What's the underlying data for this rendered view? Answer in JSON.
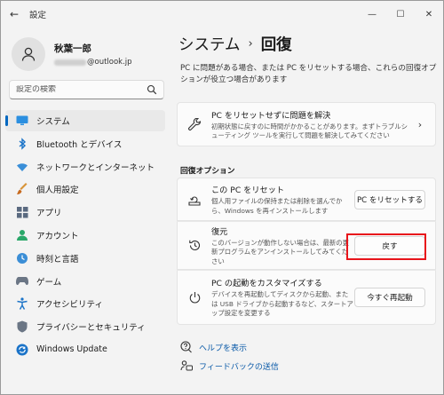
{
  "app": {
    "title": "設定"
  },
  "window_controls": {
    "minimize": "—",
    "maximize": "☐",
    "close": "✕"
  },
  "profile": {
    "name": "秋葉一郎",
    "email_domain": "@outlook.jp"
  },
  "search": {
    "placeholder": "設定の検索"
  },
  "sidebar": {
    "items": [
      {
        "label": "システム",
        "icon": "system-icon",
        "active": true
      },
      {
        "label": "Bluetooth とデバイス",
        "icon": "bluetooth-icon"
      },
      {
        "label": "ネットワークとインターネット",
        "icon": "wifi-icon"
      },
      {
        "label": "個人用設定",
        "icon": "brush-icon"
      },
      {
        "label": "アプリ",
        "icon": "apps-icon"
      },
      {
        "label": "アカウント",
        "icon": "account-icon"
      },
      {
        "label": "時刻と言語",
        "icon": "time-language-icon"
      },
      {
        "label": "ゲーム",
        "icon": "game-icon"
      },
      {
        "label": "アクセシビリティ",
        "icon": "accessibility-icon"
      },
      {
        "label": "プライバシーとセキュリティ",
        "icon": "shield-icon"
      },
      {
        "label": "Windows Update",
        "icon": "update-icon"
      }
    ]
  },
  "main": {
    "breadcrumb": {
      "parent": "システム",
      "separator": "›",
      "current": "回復"
    },
    "intro": "PC に問題がある場合、または PC をリセットする場合、これらの回復オプションが役立つ場合があります",
    "troubleshoot_card": {
      "title": "PC をリセットせずに問題を解決",
      "desc": "初期状態に戻すのに時間がかかることがあります。まずトラブルシューティング ツールを実行して問題を解決してみてください",
      "chevron": "›"
    },
    "section_label": "回復オプション",
    "options": [
      {
        "title": "この PC をリセット",
        "desc": "個人用ファイルの保持または削除を選んでから、Windows を再インストールします",
        "button": "PC をリセットする",
        "icon": "reset-pc-icon"
      },
      {
        "title": "復元",
        "desc": "このバージョンが動作しない場合は、最新の更新プログラムをアンインストールしてみてください",
        "button": "戻す",
        "icon": "restore-icon"
      },
      {
        "title": "PC の起動をカスタマイズする",
        "desc": "デバイスを再起動してディスクから起動、または USB ドライブから起動するなど、スタートアップ設定を変更する",
        "button": "今すぐ再起動",
        "icon": "power-icon"
      }
    ],
    "links": [
      {
        "label": "ヘルプを表示",
        "icon": "help-icon"
      },
      {
        "label": "フィードバックの送信",
        "icon": "feedback-icon"
      }
    ]
  },
  "colors": {
    "accent": "#0067c0",
    "highlight_border": "#e8141b",
    "link": "#0a5aa8"
  }
}
